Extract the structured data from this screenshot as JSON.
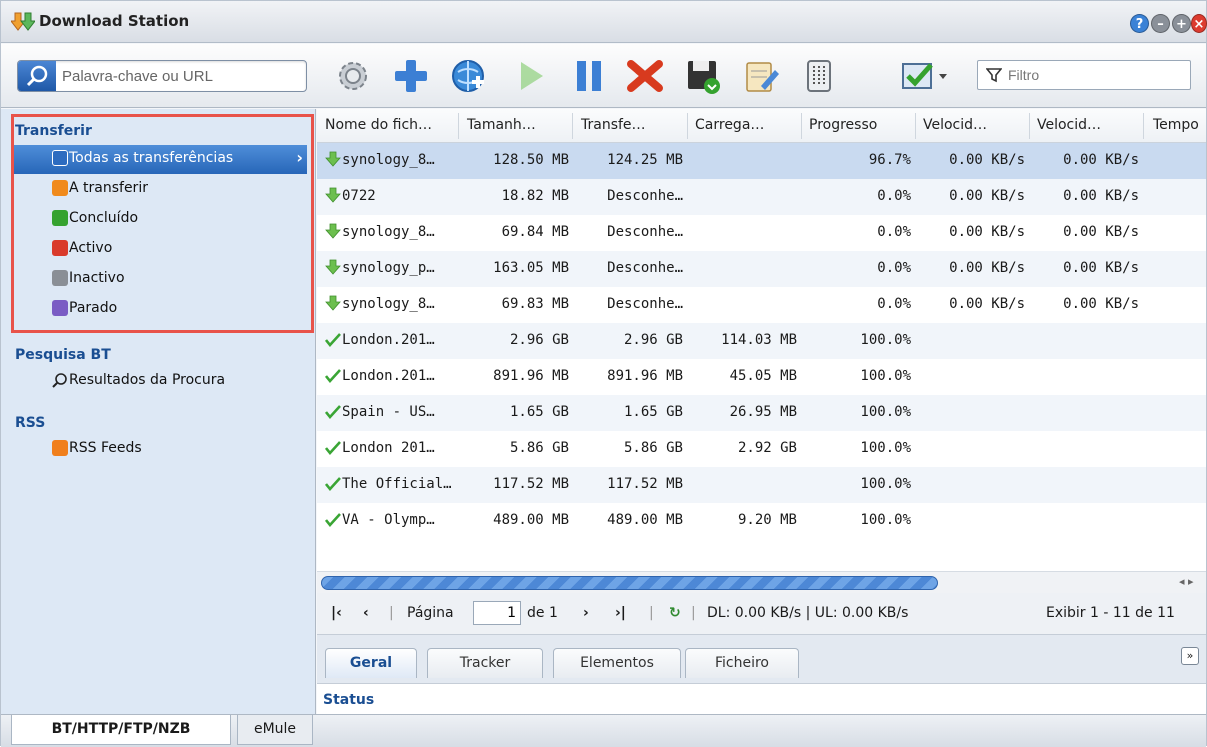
{
  "window": {
    "title": "Download Station"
  },
  "toolbar": {
    "search_placeholder": "Palavra-chave ou URL",
    "filter_placeholder": "Filtro",
    "buttons": [
      "gear-icon",
      "add-icon",
      "add-url-icon",
      "resume-icon",
      "pause-icon",
      "delete-icon",
      "save-icon",
      "edit-icon",
      "clear-icon",
      "select-icon"
    ]
  },
  "sidebar": {
    "transfer_title": "Transferir",
    "items": [
      {
        "label": "Todas as transferências",
        "icon": "list-icon",
        "color": "#2d6cc0"
      },
      {
        "label": "A transferir",
        "icon": "download-icon",
        "color": "#f08a1c"
      },
      {
        "label": "Concluído",
        "icon": "check-icon",
        "color": "#35a22f"
      },
      {
        "label": "Activo",
        "icon": "active-icon",
        "color": "#d93a2b"
      },
      {
        "label": "Inactivo",
        "icon": "inactive-icon",
        "color": "#8a8f96"
      },
      {
        "label": "Parado",
        "icon": "pause-icon",
        "color": "#7a5cc4"
      }
    ],
    "bt_title": "Pesquisa BT",
    "bt_results": "Resultados da Procura",
    "rss_title": "RSS",
    "rss_feeds": "RSS Feeds"
  },
  "table": {
    "columns": [
      "Nome do fich…",
      "Tamanh…",
      "Transfe…",
      "Carrega…",
      "Progresso",
      "Velocid…",
      "Velocid…",
      "Tempo"
    ],
    "rows": [
      {
        "status": "downloading",
        "name": "synology_8…",
        "size": "128.50 MB",
        "transferred": "124.25 MB",
        "uploaded": "",
        "progress": "96.7%",
        "dl": "0.00 KB/s",
        "ul": "0.00 KB/s"
      },
      {
        "status": "downloading",
        "name": "0722",
        "size": "18.82 MB",
        "transferred": "Desconhe…",
        "uploaded": "",
        "progress": "0.0%",
        "dl": "0.00 KB/s",
        "ul": "0.00 KB/s"
      },
      {
        "status": "downloading",
        "name": "synology_8…",
        "size": "69.84 MB",
        "transferred": "Desconhe…",
        "uploaded": "",
        "progress": "0.0%",
        "dl": "0.00 KB/s",
        "ul": "0.00 KB/s"
      },
      {
        "status": "downloading",
        "name": "synology_p…",
        "size": "163.05 MB",
        "transferred": "Desconhe…",
        "uploaded": "",
        "progress": "0.0%",
        "dl": "0.00 KB/s",
        "ul": "0.00 KB/s"
      },
      {
        "status": "downloading",
        "name": "synology_8…",
        "size": "69.83 MB",
        "transferred": "Desconhe…",
        "uploaded": "",
        "progress": "0.0%",
        "dl": "0.00 KB/s",
        "ul": "0.00 KB/s"
      },
      {
        "status": "done",
        "name": "London.201…",
        "size": "2.96 GB",
        "transferred": "2.96 GB",
        "uploaded": "114.03 MB",
        "progress": "100.0%",
        "dl": "",
        "ul": ""
      },
      {
        "status": "done",
        "name": "London.201…",
        "size": "891.96 MB",
        "transferred": "891.96 MB",
        "uploaded": "45.05 MB",
        "progress": "100.0%",
        "dl": "",
        "ul": ""
      },
      {
        "status": "done",
        "name": "Spain - US…",
        "size": "1.65 GB",
        "transferred": "1.65 GB",
        "uploaded": "26.95 MB",
        "progress": "100.0%",
        "dl": "",
        "ul": ""
      },
      {
        "status": "done",
        "name": "London 201…",
        "size": "5.86 GB",
        "transferred": "5.86 GB",
        "uploaded": "2.92 GB",
        "progress": "100.0%",
        "dl": "",
        "ul": ""
      },
      {
        "status": "done",
        "name": "The Official…",
        "size": "117.52 MB",
        "transferred": "117.52 MB",
        "uploaded": "",
        "progress": "100.0%",
        "dl": "",
        "ul": ""
      },
      {
        "status": "done",
        "name": "VA - Olymp…",
        "size": "489.00 MB",
        "transferred": "489.00 MB",
        "uploaded": "9.20 MB",
        "progress": "100.0%",
        "dl": "",
        "ul": ""
      }
    ]
  },
  "pager": {
    "page_label": "Página",
    "page_value": "1",
    "of_label": "de 1",
    "speed": "DL: 0.00 KB/s | UL: 0.00 KB/s",
    "display": "Exibir 1 - 11 de 11"
  },
  "detail_tabs": [
    "Geral",
    "Tracker",
    "Elementos",
    "Ficheiro"
  ],
  "status_label": "Status",
  "bottom_tabs": [
    "BT/HTTP/FTP/NZB",
    "eMule"
  ],
  "colors": {
    "accent": "#2766b8",
    "highlight": "#e8534a"
  }
}
